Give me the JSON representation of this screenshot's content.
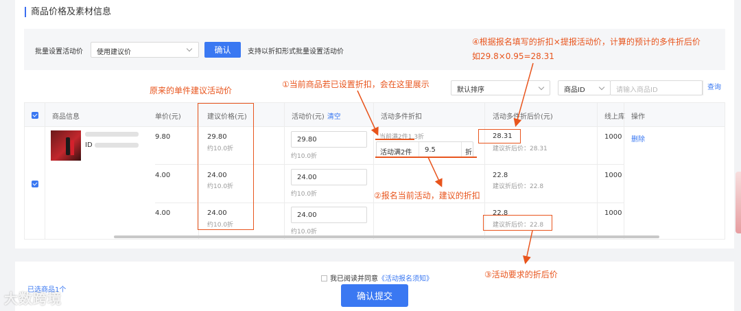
{
  "section": {
    "title": "商品价格及素材信息"
  },
  "batch": {
    "label": "批量设置活动价",
    "select_value": "使用建议价",
    "confirm_label": "确认",
    "hint": "支持以折扣形式批量设置活动价"
  },
  "filters": {
    "sort_value": "默认排序",
    "id_type": "商品ID",
    "search_placeholder": "请输入商品ID",
    "query_label": "查询"
  },
  "table": {
    "headers": {
      "product": "商品信息",
      "unit_price": "单价(元)",
      "suggest_price": "建议价格(元)",
      "activity_price": "活动价(元)",
      "clear": "清空",
      "multi_discount": "活动多件折扣",
      "after_price": "活动多件折后价(元)",
      "online_stock": "线上库",
      "ops": "操作"
    },
    "product_id_prefix": "ID",
    "rows": [
      {
        "unit_price": "9.80",
        "suggest_price": "29.80",
        "suggest_discount": "约10.0折",
        "activity_price": "29.80",
        "activity_discount": "约10.0折",
        "after_price": "28.31",
        "after_suggest": "建议折后价：28.31",
        "stock": "1000"
      },
      {
        "unit_price": "4.00",
        "suggest_price": "24.00",
        "suggest_discount": "约10.0折",
        "activity_price": "24.00",
        "activity_discount": "约10.0折",
        "after_price": "22.8",
        "after_suggest": "建议折后价：22.8",
        "stock": "1000"
      },
      {
        "unit_price": "4.00",
        "suggest_price": "24.00",
        "suggest_discount": "约10.0折",
        "activity_price": "24.00",
        "activity_discount": "约10.0折",
        "after_price": "22.8",
        "after_suggest": "建议折后价：22.8",
        "stock": "1000"
      }
    ],
    "current_discount": "当前满2件1.3折",
    "discount_rule": "活动满2件",
    "discount_value": "9.5",
    "discount_unit": "折",
    "delete_label": "删除"
  },
  "annotations": {
    "a1": "①当前商品若已设置折扣，会在这里展示",
    "a2": "②报名当前活动，建议的折扣",
    "a3": "③活动要求的折后价",
    "a4_line1": "④根据报名填写的折扣×提报活动价，计算的预计的多件折后价",
    "a4_line2": "如29.8×0.95=28.31",
    "orig": "原来的单件建议活动价"
  },
  "footer": {
    "agree_text": "我已阅读并同意",
    "agree_link": "《活动报名须知》",
    "submit_label": "确认提交",
    "selected_count": "已选商品1个"
  },
  "watermark": "大数跨境",
  "colors": {
    "accent": "#3a78f2",
    "annotation": "#e8541c"
  }
}
